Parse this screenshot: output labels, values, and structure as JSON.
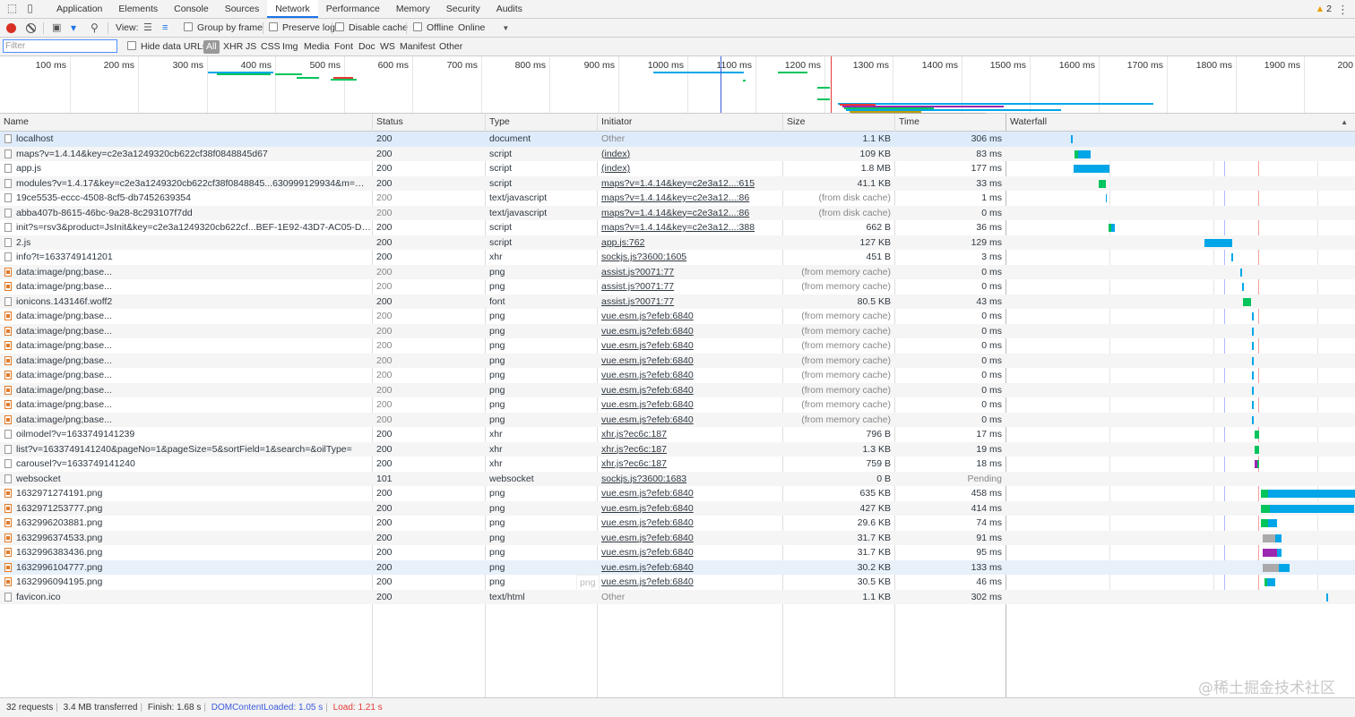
{
  "tabs": [
    "Application",
    "Elements",
    "Console",
    "Sources",
    "Network",
    "Performance",
    "Memory",
    "Security",
    "Audits"
  ],
  "active_tab": "Network",
  "warnings": "2",
  "toolbar": {
    "view_label": "View:",
    "group_by_frame": "Group by frame",
    "preserve_log": "Preserve log",
    "disable_cache": "Disable cache",
    "offline": "Offline",
    "throttle": "Online"
  },
  "filter": {
    "placeholder": "Filter",
    "hide_data_urls": "Hide data URLs",
    "types": [
      "All",
      "XHR",
      "JS",
      "CSS",
      "Img",
      "Media",
      "Font",
      "Doc",
      "WS",
      "Manifest",
      "Other"
    ]
  },
  "overview": {
    "ticks": [
      "100 ms",
      "200 ms",
      "300 ms",
      "400 ms",
      "500 ms",
      "600 ms",
      "700 ms",
      "800 ms",
      "900 ms",
      "1000 ms",
      "1100 ms",
      "1200 ms",
      "1300 ms",
      "1400 ms",
      "1500 ms",
      "1600 ms",
      "1700 ms",
      "1800 ms",
      "1900 ms",
      "200"
    ]
  },
  "columns": [
    "Name",
    "Status",
    "Type",
    "Initiator",
    "Size",
    "Time",
    "Waterfall"
  ],
  "requests": [
    {
      "name": "localhost",
      "status": "200",
      "type": "document",
      "initiator": "Other",
      "size": "1.1 KB",
      "time": "306 ms",
      "kind": "doc"
    },
    {
      "name": "maps?v=1.4.14&key=c2e3a1249320cb622cf38f0848845d67",
      "status": "200",
      "type": "script",
      "initiator": "(index)",
      "size": "109 KB",
      "time": "83 ms",
      "kind": "doc"
    },
    {
      "name": "app.js",
      "status": "200",
      "type": "script",
      "initiator": "(index)",
      "size": "1.8 MB",
      "time": "177 ms",
      "kind": "doc"
    },
    {
      "name": "modules?v=1.4.17&key=c2e3a1249320cb622cf38f0848845...630999129934&m=mouse,vect...",
      "status": "200",
      "type": "script",
      "initiator": "maps?v=1.4.14&key=c2e3a12...:615",
      "size": "41.1 KB",
      "time": "33 ms",
      "kind": "doc"
    },
    {
      "name": "19ce5535-eccc-4508-8cf5-db7452639354",
      "status": "200",
      "type": "text/javascript",
      "initiator": "maps?v=1.4.14&key=c2e3a12...:86",
      "size": "(from disk cache)",
      "time": "1 ms",
      "kind": "doc"
    },
    {
      "name": "abba407b-8615-46bc-9a28-8c293107f7dd",
      "status": "200",
      "type": "text/javascript",
      "initiator": "maps?v=1.4.14&key=c2e3a12...:86",
      "size": "(from disk cache)",
      "time": "0 ms",
      "kind": "doc"
    },
    {
      "name": "init?s=rsv3&product=JsInit&key=c2e3a1249320cb622cf...BEF-1E92-43D7-AC05-D3D20CFCF...",
      "status": "200",
      "type": "script",
      "initiator": "maps?v=1.4.14&key=c2e3a12...:388",
      "size": "662 B",
      "time": "36 ms",
      "kind": "doc"
    },
    {
      "name": "2.js",
      "status": "200",
      "type": "script",
      "initiator": "app.js:762",
      "size": "127 KB",
      "time": "129 ms",
      "kind": "doc"
    },
    {
      "name": "info?t=1633749141201",
      "status": "200",
      "type": "xhr",
      "initiator": "sockjs.js?3600:1605",
      "size": "451 B",
      "time": "3 ms",
      "kind": "doc"
    },
    {
      "name": "data:image/png;base...",
      "status": "200",
      "type": "png",
      "initiator": "assist.js?0071:77",
      "size": "(from memory cache)",
      "time": "0 ms",
      "kind": "img"
    },
    {
      "name": "data:image/png;base...",
      "status": "200",
      "type": "png",
      "initiator": "assist.js?0071:77",
      "size": "(from memory cache)",
      "time": "0 ms",
      "kind": "img"
    },
    {
      "name": "ionicons.143146f.woff2",
      "status": "200",
      "type": "font",
      "initiator": "assist.js?0071:77",
      "size": "80.5 KB",
      "time": "43 ms",
      "kind": "doc"
    },
    {
      "name": "data:image/png;base...",
      "status": "200",
      "type": "png",
      "initiator": "vue.esm.js?efeb:6840",
      "size": "(from memory cache)",
      "time": "0 ms",
      "kind": "img"
    },
    {
      "name": "data:image/png;base...",
      "status": "200",
      "type": "png",
      "initiator": "vue.esm.js?efeb:6840",
      "size": "(from memory cache)",
      "time": "0 ms",
      "kind": "img"
    },
    {
      "name": "data:image/png;base...",
      "status": "200",
      "type": "png",
      "initiator": "vue.esm.js?efeb:6840",
      "size": "(from memory cache)",
      "time": "0 ms",
      "kind": "img"
    },
    {
      "name": "data:image/png;base...",
      "status": "200",
      "type": "png",
      "initiator": "vue.esm.js?efeb:6840",
      "size": "(from memory cache)",
      "time": "0 ms",
      "kind": "img"
    },
    {
      "name": "data:image/png;base...",
      "status": "200",
      "type": "png",
      "initiator": "vue.esm.js?efeb:6840",
      "size": "(from memory cache)",
      "time": "0 ms",
      "kind": "img"
    },
    {
      "name": "data:image/png;base...",
      "status": "200",
      "type": "png",
      "initiator": "vue.esm.js?efeb:6840",
      "size": "(from memory cache)",
      "time": "0 ms",
      "kind": "img"
    },
    {
      "name": "data:image/png;base...",
      "status": "200",
      "type": "png",
      "initiator": "vue.esm.js?efeb:6840",
      "size": "(from memory cache)",
      "time": "0 ms",
      "kind": "img"
    },
    {
      "name": "data:image/png;base...",
      "status": "200",
      "type": "png",
      "initiator": "vue.esm.js?efeb:6840",
      "size": "(from memory cache)",
      "time": "0 ms",
      "kind": "img"
    },
    {
      "name": "oilmodel?v=1633749141239",
      "status": "200",
      "type": "xhr",
      "initiator": "xhr.js?ec6c:187",
      "size": "796 B",
      "time": "17 ms",
      "kind": "doc"
    },
    {
      "name": "list?v=1633749141240&pageNo=1&pageSize=5&sortField=1&search=&oilType=",
      "status": "200",
      "type": "xhr",
      "initiator": "xhr.js?ec6c:187",
      "size": "1.3 KB",
      "time": "19 ms",
      "kind": "doc"
    },
    {
      "name": "carousel?v=1633749141240",
      "status": "200",
      "type": "xhr",
      "initiator": "xhr.js?ec6c:187",
      "size": "759 B",
      "time": "18 ms",
      "kind": "doc"
    },
    {
      "name": "websocket",
      "status": "101",
      "type": "websocket",
      "initiator": "sockjs.js?3600:1683",
      "size": "0 B",
      "time": "Pending",
      "kind": "doc"
    },
    {
      "name": "1632971274191.png",
      "status": "200",
      "type": "png",
      "initiator": "vue.esm.js?efeb:6840",
      "size": "635 KB",
      "time": "458 ms",
      "kind": "img"
    },
    {
      "name": "1632971253777.png",
      "status": "200",
      "type": "png",
      "initiator": "vue.esm.js?efeb:6840",
      "size": "427 KB",
      "time": "414 ms",
      "kind": "img"
    },
    {
      "name": "1632996203881.png",
      "status": "200",
      "type": "png",
      "initiator": "vue.esm.js?efeb:6840",
      "size": "29.6 KB",
      "time": "74 ms",
      "kind": "img"
    },
    {
      "name": "1632996374533.png",
      "status": "200",
      "type": "png",
      "initiator": "vue.esm.js?efeb:6840",
      "size": "31.7 KB",
      "time": "91 ms",
      "kind": "img"
    },
    {
      "name": "1632996383436.png",
      "status": "200",
      "type": "png",
      "initiator": "vue.esm.js?efeb:6840",
      "size": "31.7 KB",
      "time": "95 ms",
      "kind": "img"
    },
    {
      "name": "1632996104777.png",
      "status": "200",
      "type": "png",
      "initiator": "vue.esm.js?efeb:6840",
      "size": "30.2 KB",
      "time": "133 ms",
      "kind": "img"
    },
    {
      "name": "1632996094195.png",
      "status": "200",
      "type": "png",
      "initiator": "vue.esm.js?efeb:6840",
      "size": "30.5 KB",
      "time": "46 ms",
      "kind": "img"
    },
    {
      "name": "favicon.ico",
      "status": "200",
      "type": "text/html",
      "initiator": "Other",
      "size": "1.1 KB",
      "time": "302 ms",
      "kind": "doc"
    }
  ],
  "hover_hint": "png",
  "status": {
    "requests": "32 requests",
    "transferred": "3.4 MB transferred",
    "finish": "Finish: 1.68 s",
    "dcl": "DOMContentLoaded: 1.05 s",
    "load": "Load: 1.21 s"
  },
  "watermark": "@稀土掘金技术社区",
  "colors": {
    "accent": "#1a73e8",
    "record": "#d93025",
    "waterfall_download": "#00a6e8",
    "waterfall_wait": "#00c45c",
    "dcl_line": "#3b5bdb",
    "load_line": "#e53935"
  }
}
